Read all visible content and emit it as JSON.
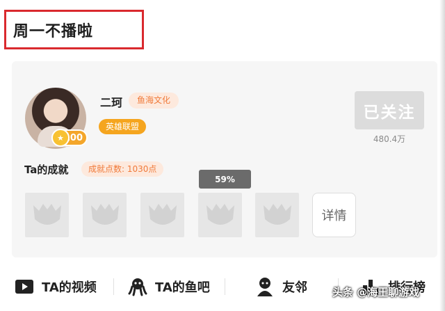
{
  "header": {
    "title": "周一不播啦"
  },
  "profile": {
    "name": "二珂",
    "team_tag": "鱼海文化",
    "game_tag": "英雄联盟",
    "level": "100",
    "follow_label": "已关注",
    "followers": "480.4万"
  },
  "achievements": {
    "title": "Ta的成就",
    "points": "成就点数: 1030点",
    "progress_percent": 59,
    "progress_label": "59%",
    "details_label": "详情",
    "badges": [
      "locked-badge-icon",
      "locked-badge-icon",
      "locked-badge-icon",
      "locked-badge-icon",
      "locked-badge-icon"
    ]
  },
  "tabs": [
    {
      "label": "TA的视频",
      "icon": "video-play-icon"
    },
    {
      "label": "TA的鱼吧",
      "icon": "octopus-icon"
    },
    {
      "label": "友邻",
      "icon": "user-icon"
    },
    {
      "label": "排行榜",
      "icon": "bar-chart-icon"
    }
  ],
  "watermark": "头条 @海王聊游戏"
}
